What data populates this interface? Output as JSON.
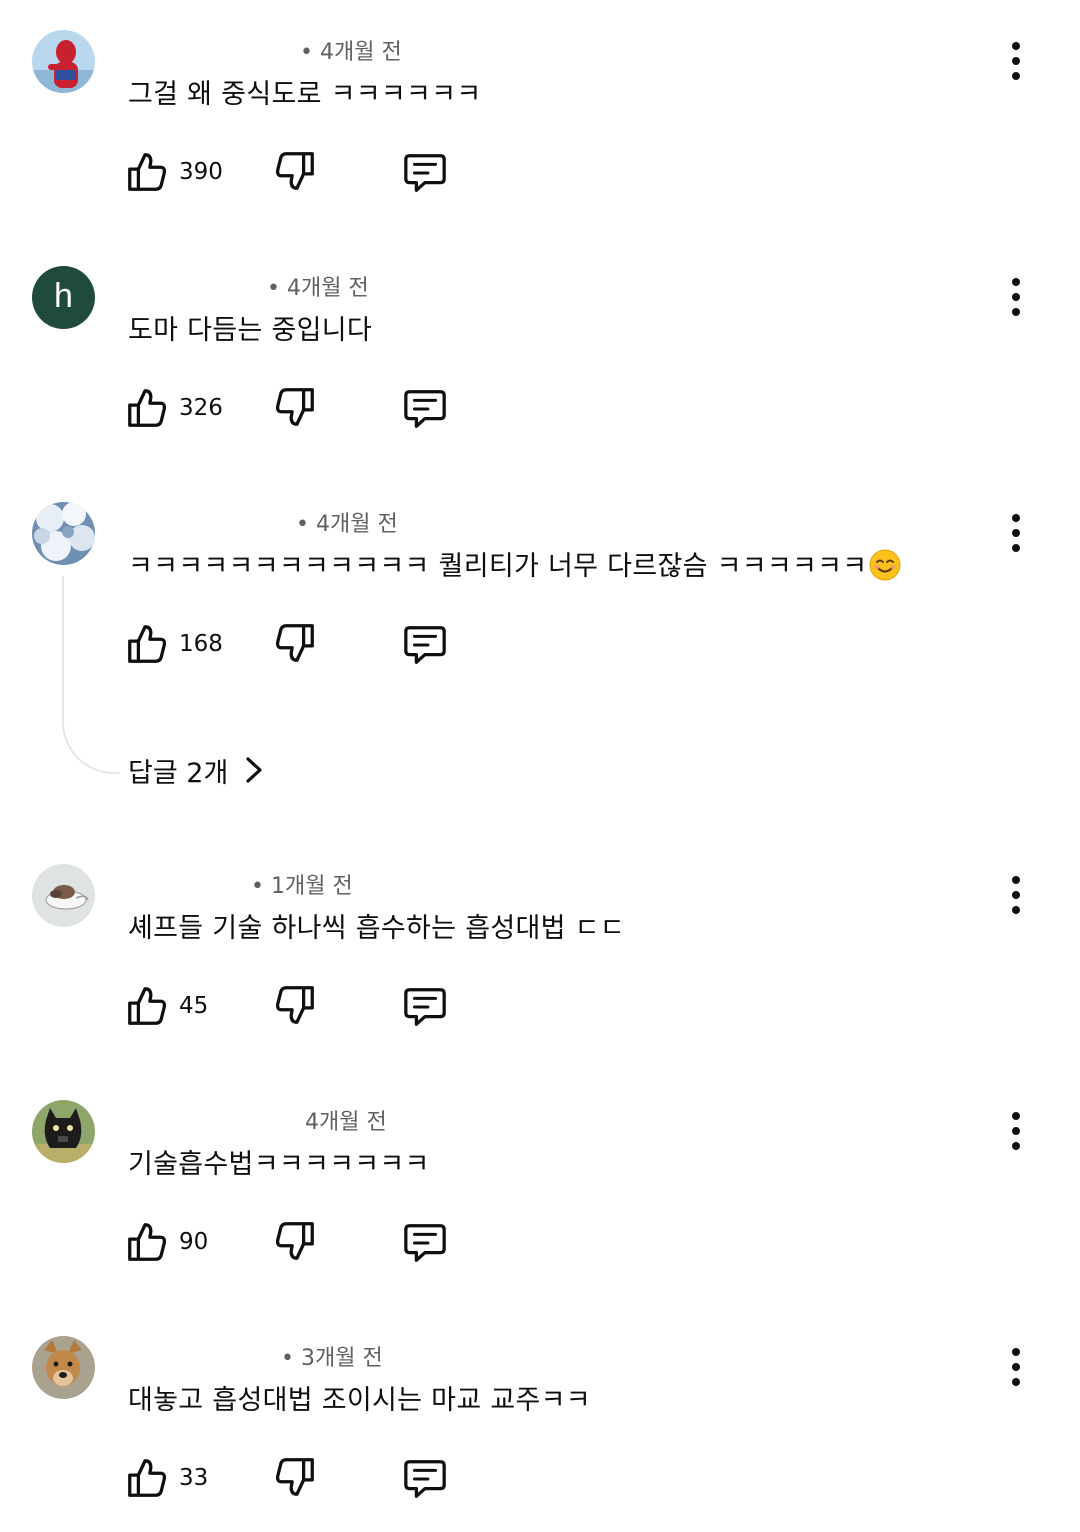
{
  "comments": [
    {
      "time": "• 4개월 전",
      "text": "그걸 왜 중식도로 ㅋㅋㅋㅋㅋㅋ",
      "likes": "390",
      "avatar_icon": "spiderman-avatar-icon"
    },
    {
      "time": "• 4개월 전",
      "text": "도마 다듬는 중입니다",
      "likes": "326",
      "avatar_letter": "h",
      "avatar_color": "#1f4a3c"
    },
    {
      "time": "• 4개월 전",
      "text": "ㅋㅋㅋㅋㅋㅋㅋㅋㅋㅋㅋㅋ 퀄리티가 너무 다르잖슴 ㅋㅋㅋㅋㅋㅋ",
      "emoji": "smiling-face-emoji",
      "likes": "168",
      "replies_label": "답글 2개",
      "avatar_icon": "clouds-avatar-icon"
    },
    {
      "time": "• 1개월 전",
      "text": "셰프들 기술 하나씩 흡수하는 흡성대법 ㄷㄷ",
      "likes": "45",
      "avatar_icon": "sleeping-animal-avatar-icon"
    },
    {
      "time": "4개월 전",
      "text": "기술흡수법ㅋㅋㅋㅋㅋㅋㅋ",
      "likes": "90",
      "avatar_icon": "cartoon-cat-avatar-icon"
    },
    {
      "time": "• 3개월 전",
      "text": "대놓고 흡성대법 조이시는 마교 교주ㅋㅋ",
      "likes": "33",
      "avatar_icon": "dog-avatar-icon"
    }
  ],
  "icons": {
    "like": "thumbs-up-icon",
    "dislike": "thumbs-down-icon",
    "reply": "comment-reply-icon",
    "more": "more-vertical-icon",
    "chevron": "chevron-right-icon"
  }
}
